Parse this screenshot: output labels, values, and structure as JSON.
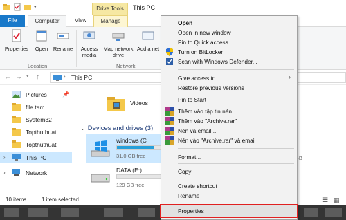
{
  "window": {
    "title": "This PC",
    "contextual_tab_group": "Drive Tools"
  },
  "tabs": [
    {
      "label": "File"
    },
    {
      "label": "Computer"
    },
    {
      "label": "View"
    },
    {
      "label": "Manage"
    }
  ],
  "ribbon": {
    "buttons": [
      {
        "label": "Properties",
        "icon": "properties-icon"
      },
      {
        "label": "Open",
        "icon": "open-icon"
      },
      {
        "label": "Rename",
        "icon": "rename-icon"
      },
      {
        "label": "Access media",
        "icon": "access-media-icon"
      },
      {
        "label": "Map network drive",
        "icon": "map-network-drive-icon"
      },
      {
        "label": "Add a net",
        "icon": "add-network-location-icon"
      }
    ],
    "groups": [
      {
        "label": "Location"
      },
      {
        "label": "Network"
      }
    ]
  },
  "address": {
    "path": "This PC"
  },
  "nav": {
    "items": [
      {
        "label": "Pictures",
        "icon": "pictures-icon",
        "pinned": true
      },
      {
        "label": "file tam",
        "icon": "folder-icon"
      },
      {
        "label": "System32",
        "icon": "folder-icon"
      },
      {
        "label": "Topthuthuat",
        "icon": "folder-icon"
      },
      {
        "label": "Topthuthuat",
        "icon": "folder-icon"
      },
      {
        "label": "This PC",
        "icon": "this-pc-icon",
        "selected": true
      },
      {
        "label": "Network",
        "icon": "network-icon"
      }
    ]
  },
  "content": {
    "folders": [
      {
        "label": "Videos"
      }
    ],
    "group_header": "Devices and drives (3)",
    "drives": [
      {
        "name": "windows (C",
        "free": "31.0 GB free",
        "used_fraction": 0.72,
        "selected": true
      },
      {
        "name": "DATA (E:)",
        "free": "129 GB free",
        "used_fraction": 0.0
      },
      {
        "free": "GB"
      }
    ]
  },
  "status": {
    "items_count": "10 items",
    "selection": "1 item selected"
  },
  "context_menu": {
    "items": [
      {
        "label": "Open",
        "bold": true
      },
      {
        "label": "Open in new window"
      },
      {
        "label": "Pin to Quick access"
      },
      {
        "label": "Turn on BitLocker",
        "icon": "shield-icon"
      },
      {
        "label": "Scan with Windows Defender...",
        "icon": "defender-icon"
      },
      {
        "label": "Give access to",
        "submenu": true
      },
      {
        "label": "Restore previous versions"
      },
      {
        "label": "Pin to Start"
      },
      {
        "label": "Thêm vào tập tin nén...",
        "icon": "winrar-icon"
      },
      {
        "label": "Thêm vào \"Archive.rar\"",
        "icon": "winrar-icon"
      },
      {
        "label": "Nén và email...",
        "icon": "winrar-icon"
      },
      {
        "label": "Nén vào \"Archive.rar\" và email",
        "icon": "winrar-icon"
      },
      {
        "label": "Format..."
      },
      {
        "label": "Copy"
      },
      {
        "label": "Create shortcut"
      },
      {
        "label": "Rename"
      },
      {
        "label": "Properties",
        "highlighted": true
      }
    ]
  },
  "colors": {
    "accent": "#1979ca",
    "selection": "#cce8ff",
    "drive_tools": "#f6e8a3",
    "highlight_border": "#e02020"
  }
}
